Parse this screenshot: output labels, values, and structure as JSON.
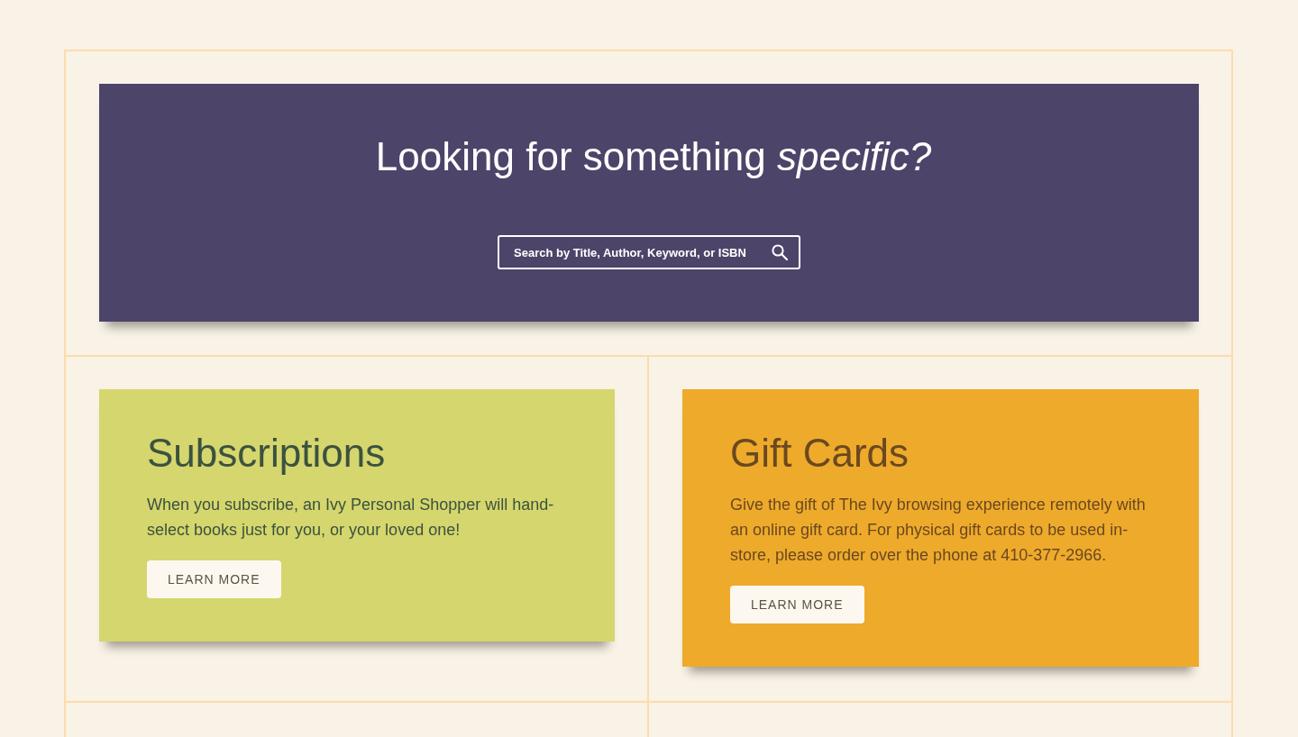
{
  "search_banner": {
    "heading": "Looking for something *specific?*",
    "search": {
      "placeholder": "Search by Title, Author, Keyword, or ISBN"
    }
  },
  "cards": [
    {
      "title": {
        "text": "Subscriptions",
        "color": "#3c5240"
      },
      "text": "When you subscribe, an Ivy Personal Shopper will hand-select books just for you, or your loved one!",
      "button": "LEARN MORE",
      "color": "#d5d66d"
    },
    {
      "title": {
        "text": "Gift Cards",
        "color": "#6a4820"
      },
      "text": "Give the gift of The Ivy browsing experience remotely with an online gift card. For physical gift cards to be used in-store, please order over the phone at 410-377-2966.",
      "button": "LEARN MORE",
      "color": "#eeaa2b"
    }
  ]
}
